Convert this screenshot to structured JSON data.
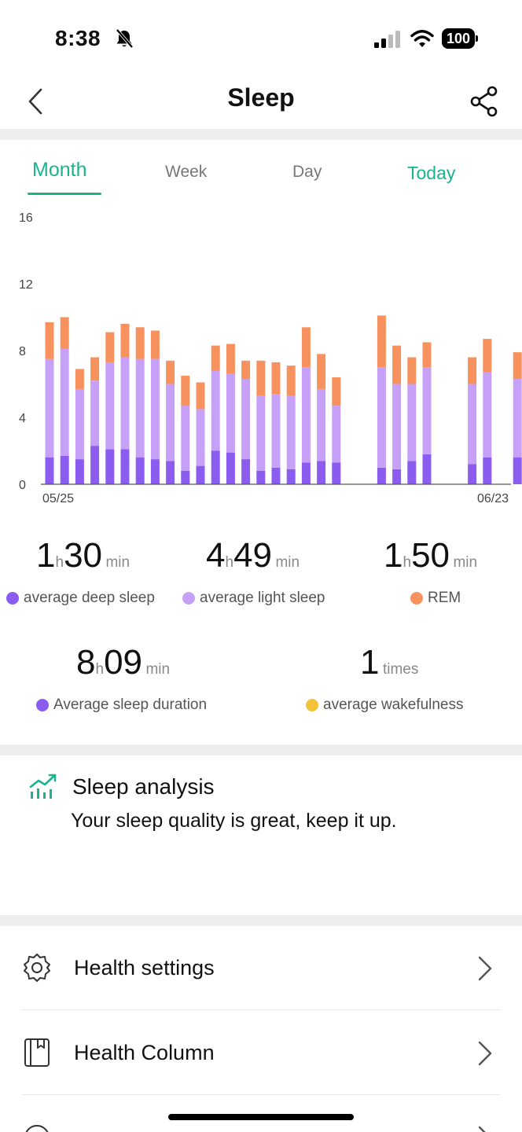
{
  "status_bar": {
    "time": "8:38",
    "battery": "100"
  },
  "header": {
    "title": "Sleep"
  },
  "tabs": [
    {
      "label": "Month"
    },
    {
      "label": "Week"
    },
    {
      "label": "Day"
    },
    {
      "label": "Today"
    }
  ],
  "colors": {
    "accent": "#19b48f",
    "deep": "#8b5cf0",
    "light": "#c7a0f7",
    "rem": "#f7915e",
    "awake": "#f3c33b"
  },
  "chart_data": {
    "type": "bar",
    "stacked": true,
    "y_ticks": [
      "16",
      "12",
      "8",
      "4",
      "0"
    ],
    "ylim": [
      0,
      16
    ],
    "x_start_label": "05/25",
    "x_end_label": "06/23",
    "grid": false,
    "series": [
      {
        "key": "deep",
        "values": [
          1.6,
          1.7,
          1.5,
          2.3,
          2.1,
          2.1,
          1.6,
          1.5,
          1.4,
          0.8,
          1.1,
          2.0,
          1.9,
          1.5,
          0.8,
          1.0,
          0.9,
          1.3,
          1.4,
          1.3,
          0,
          0,
          1.0,
          0.9,
          1.4,
          1.8,
          0,
          0,
          1.2,
          1.6,
          0,
          1.6
        ]
      },
      {
        "key": "light",
        "values": [
          5.9,
          6.4,
          4.2,
          3.9,
          5.2,
          5.5,
          5.9,
          6.0,
          4.6,
          3.9,
          3.4,
          4.8,
          4.7,
          4.8,
          4.5,
          4.4,
          4.4,
          5.7,
          4.3,
          3.4,
          0,
          0,
          6.0,
          5.1,
          4.6,
          5.2,
          0,
          0,
          4.8,
          5.1,
          0,
          4.7
        ]
      },
      {
        "key": "rem",
        "values": [
          2.2,
          1.9,
          1.2,
          1.4,
          1.8,
          2.0,
          1.9,
          1.7,
          1.4,
          1.8,
          1.6,
          1.5,
          1.8,
          1.1,
          2.1,
          1.9,
          1.8,
          2.4,
          2.1,
          1.7,
          0,
          0,
          3.1,
          2.3,
          1.6,
          1.5,
          0,
          0,
          1.6,
          2.0,
          0,
          1.6
        ]
      }
    ]
  },
  "stats": {
    "deep": {
      "hours": "1",
      "h_unit": "h",
      "minutes": "30",
      "min_unit": "min",
      "label": "average deep sleep"
    },
    "light": {
      "hours": "4",
      "h_unit": "h",
      "minutes": "49",
      "min_unit": "min",
      "label": "average light sleep"
    },
    "rem": {
      "hours": "1",
      "h_unit": "h",
      "minutes": "50",
      "min_unit": "min",
      "label": "REM"
    },
    "duration": {
      "hours": "8",
      "h_unit": "h",
      "minutes": "09",
      "min_unit": "min",
      "label": "Average sleep duration"
    },
    "wake": {
      "count": "1",
      "unit": "times",
      "label": "average wakefulness"
    }
  },
  "analysis": {
    "title": "Sleep analysis",
    "text": "Your sleep quality is great, keep it up."
  },
  "menu": [
    {
      "label": "Health settings",
      "icon": "gear-icon"
    },
    {
      "label": "Health Column",
      "icon": "book-icon"
    },
    {
      "label": "",
      "icon": "history-icon"
    }
  ]
}
